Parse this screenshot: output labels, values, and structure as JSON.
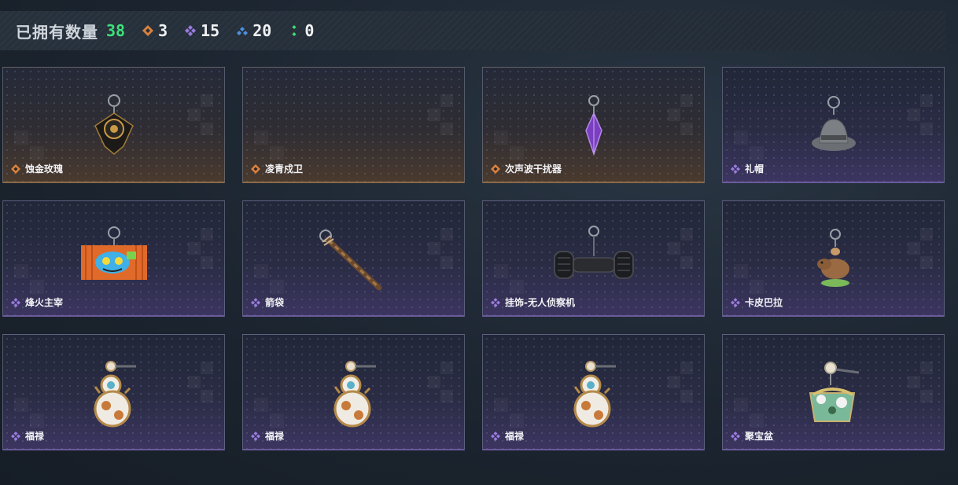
{
  "header": {
    "owned_label": "已拥有数量",
    "owned_count": "38",
    "stats": [
      {
        "icon": "orange-diamond-icon",
        "color": "#d9823f",
        "value": "3"
      },
      {
        "icon": "purple-diamond-icon",
        "color": "#9b7be0",
        "value": "15"
      },
      {
        "icon": "blue-diamond-icon",
        "color": "#4f8fe0",
        "value": "20"
      },
      {
        "icon": "green-dots-icon",
        "color": "#3ee07a",
        "value": "0"
      }
    ]
  },
  "colors": {
    "orange": "#d9823f",
    "purple": "#9b7be0"
  },
  "items": [
    {
      "name": "蚀金玫瑰",
      "rarity": "orange",
      "icon": "black-gold-rose-pendant"
    },
    {
      "name": "凌青戍卫",
      "rarity": "orange",
      "icon": "empty"
    },
    {
      "name": "次声波干扰器",
      "rarity": "orange",
      "icon": "purple-crystal-pendant"
    },
    {
      "name": "礼帽",
      "rarity": "purple",
      "icon": "gray-fedora-pendant"
    },
    {
      "name": "烽火主宰",
      "rarity": "purple",
      "icon": "graffiti-container-pendant"
    },
    {
      "name": "箭袋",
      "rarity": "purple",
      "icon": "quiver-pendant"
    },
    {
      "name": "挂饰-无人侦察机",
      "rarity": "purple",
      "icon": "drone-pendant"
    },
    {
      "name": "卡皮巴拉",
      "rarity": "purple",
      "icon": "capybara-pendant"
    },
    {
      "name": "福禄",
      "rarity": "purple",
      "icon": "gourd-pendant"
    },
    {
      "name": "福禄",
      "rarity": "purple",
      "icon": "gourd-pendant"
    },
    {
      "name": "福禄",
      "rarity": "purple",
      "icon": "gourd-pendant"
    },
    {
      "name": "聚宝盆",
      "rarity": "purple",
      "icon": "treasure-bowl-pendant"
    }
  ]
}
